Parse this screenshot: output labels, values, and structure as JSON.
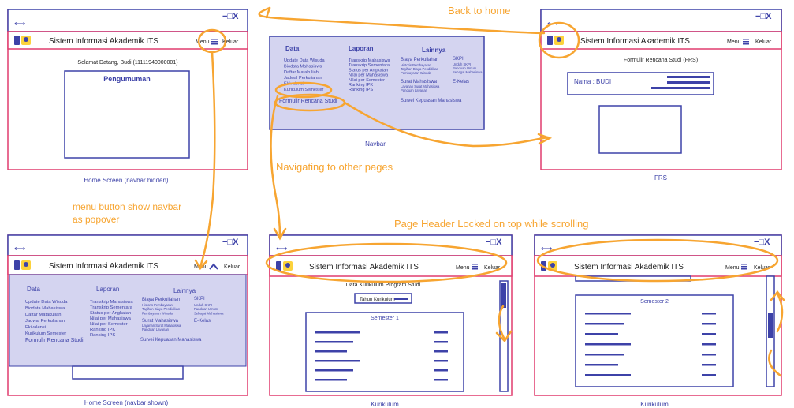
{
  "app_title": "Sistem Informasi Akademik ITS",
  "menu_label": "Menu",
  "logout_label": "Keluar",
  "welcome_text": "Selamat Datang, Budi (11111940000001)",
  "announcement_title": "Pengumuman",
  "navbar": {
    "heading_data": "Data",
    "heading_laporan": "Laporan",
    "heading_lainnya": "Lainnya",
    "data_items": [
      "Update Data Wisuda",
      "Biodata Mahasiswa",
      "Daftar Matakuliah",
      "Jadwal Perkuliahan",
      "Ekivalensi",
      "Kurikulum Semester"
    ],
    "formulir": "Formulir Rencana Studi",
    "laporan_items": [
      "Transkrip Mahasiswa",
      "Transkrip Sementara",
      "Status per Angkatan",
      "Nilai per Mahasiswa",
      "Nilai per Semester",
      "Ranking IPK",
      "Ranking IPS"
    ],
    "biaya_title": "Biaya Perkuliahan",
    "biaya_items": [
      "Historis Pembayaran",
      "Tagihan Biaya Pendidikan",
      "Pembayaran Wisuda"
    ],
    "skpi_title": "SKPI",
    "skpi_items": [
      "Unduh SKPI",
      "Panduan Umum",
      "Sebagai Mahasiswa"
    ],
    "surat_title": "Surat Mahasiswa",
    "surat_items": [
      "Layanan Surat Mahasiswa",
      "Panduan Layanan"
    ],
    "ekelas": "E-Kelas",
    "survei": "Survei Kepuasan Mahasiswa"
  },
  "frs": {
    "title": "Formulir Rencana Studi (FRS)",
    "nama": "Nama : BUDI"
  },
  "kurikulum": {
    "title": "Data Kurikulum Program Studi",
    "tahun": "Tahun Kurikulum",
    "sem1": "Semester 1",
    "sem2": "Semester 2"
  },
  "captions": {
    "home_hidden": "Home Screen (navbar hidden)",
    "navbar": "Navbar",
    "frs": "FRS",
    "home_shown": "Home Screen (navbar shown)",
    "kurikulum1": "Kurikulum",
    "kurikulum2": "Kurikulum"
  },
  "annotations": {
    "back_to_home": "Back to home",
    "navigating": "Navigating to other pages",
    "menu_popover_1": "menu button show navbar",
    "menu_popover_2": "as popover",
    "header_locked": "Page Header Locked on top while scrolling"
  },
  "colors": {
    "frame": "#e03c6e",
    "window": "#3d42a8",
    "navbg": "#d4d4f0",
    "orange": "#f7a531"
  }
}
